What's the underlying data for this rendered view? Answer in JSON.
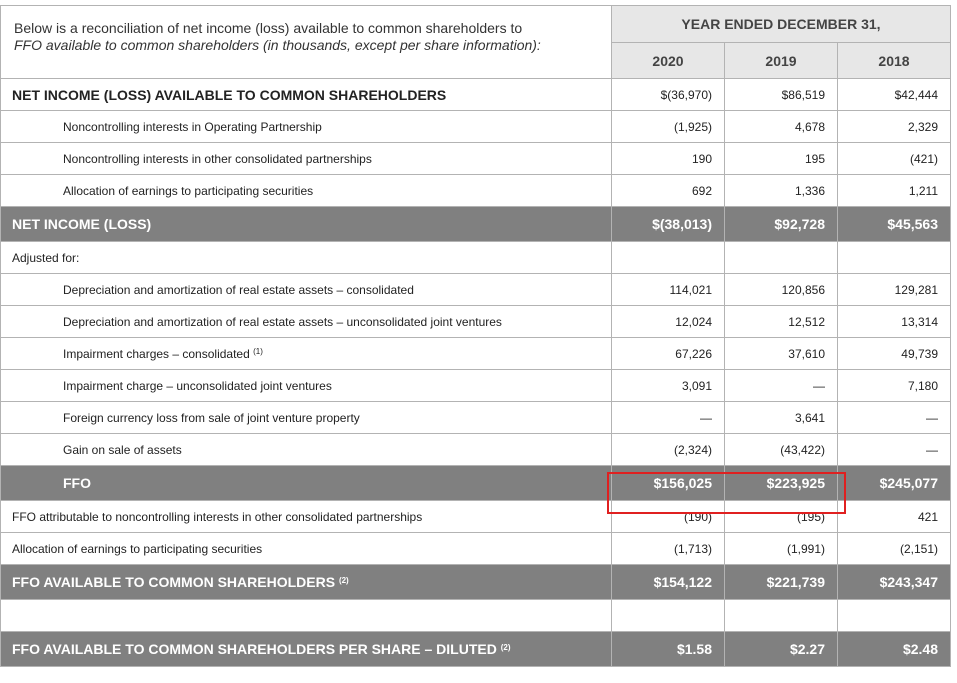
{
  "intro": {
    "line1": "Below is a reconciliation of net income (loss) available to common shareholders to",
    "line2": "FFO available to common shareholders (in thousands, except per share information):"
  },
  "header": {
    "period": "YEAR ENDED DECEMBER 31,",
    "years": [
      "2020",
      "2019",
      "2018"
    ]
  },
  "rows": [
    {
      "label": "NET INCOME (LOSS) AVAILABLE TO COMMON SHAREHOLDERS",
      "values": [
        "$(36,970)",
        "$86,519",
        "$42,444"
      ]
    },
    {
      "label": "Noncontrolling interests in Operating Partnership",
      "values": [
        "(1,925)",
        "4,678",
        "2,329"
      ]
    },
    {
      "label": "Noncontrolling interests in other consolidated partnerships",
      "values": [
        "190",
        "195",
        "(421)"
      ]
    },
    {
      "label": "Allocation of earnings to participating securities",
      "values": [
        "692",
        "1,336",
        "1,211"
      ]
    },
    {
      "label": "NET INCOME (LOSS)",
      "values": [
        "$(38,013)",
        "$92,728",
        "$45,563"
      ]
    },
    {
      "label": "Adjusted for:",
      "values": [
        "",
        "",
        ""
      ]
    },
    {
      "label": "Depreciation and amortization of real estate assets – consolidated",
      "values": [
        "114,021",
        "120,856",
        "129,281"
      ]
    },
    {
      "label": "Depreciation and amortization of real estate assets – unconsolidated joint ventures",
      "values": [
        "12,024",
        "12,512",
        "13,314"
      ]
    },
    {
      "label": "Impairment charges – consolidated",
      "note": "(1)",
      "values": [
        "67,226",
        "37,610",
        "49,739"
      ]
    },
    {
      "label": "Impairment charge – unconsolidated joint ventures",
      "values": [
        "3,091",
        "—",
        "7,180"
      ]
    },
    {
      "label": "Foreign currency loss from sale of joint venture property",
      "values": [
        "—",
        "3,641",
        "—"
      ]
    },
    {
      "label": "Gain on sale of assets",
      "values": [
        "(2,324)",
        "(43,422)",
        "—"
      ]
    },
    {
      "label": "FFO",
      "values": [
        "$156,025",
        "$223,925",
        "$245,077"
      ]
    },
    {
      "label": "FFO attributable to noncontrolling interests in other consolidated partnerships",
      "values": [
        "(190)",
        "(195)",
        "421"
      ]
    },
    {
      "label": "Allocation of earnings to participating securities",
      "values": [
        "(1,713)",
        "(1,991)",
        "(2,151)"
      ]
    },
    {
      "label": "FFO AVAILABLE TO COMMON SHAREHOLDERS",
      "note": "(2)",
      "values": [
        "$154,122",
        "$221,739",
        "$243,347"
      ]
    },
    {
      "label": "",
      "values": [
        "",
        "",
        ""
      ]
    },
    {
      "label": "FFO AVAILABLE TO COMMON SHAREHOLDERS PER SHARE – DILUTED",
      "note": "(2)",
      "values": [
        "$1.58",
        "$2.27",
        "$2.48"
      ]
    }
  ],
  "colors": {
    "dark_row": "#808080",
    "header_bg": "#e7e7e7",
    "highlight_box": "#e02020"
  }
}
